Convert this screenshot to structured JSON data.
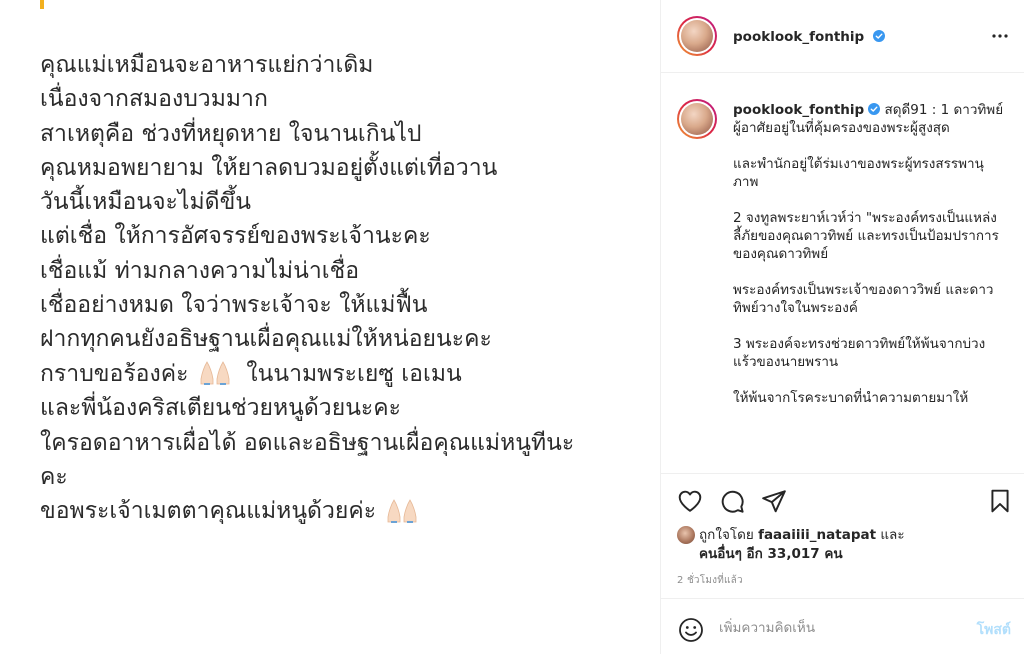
{
  "image": {
    "lines": [
      "คุณแม่เหมือนจะอาหารแย่กว่าเดิม",
      "เนื่องจากสมองบวมมาก",
      "สาเหตุคือ ช่วงที่หยุดหาย ใจนานเกินไป",
      "คุณหมอพยายาม ให้ยาลดบวมอยู่ตั้งแต่เที่อวาน",
      "วันนี้เหมือนจะไม่ดีขึ้น",
      "แต่เชื่อ ให้การอัศจรรย์ของพระเจ้านะคะ",
      "เชื่อแม้ ท่ามกลางความไม่น่าเชื่อ",
      "เชื่ออย่างหมด ใจว่าพระเจ้าจะ ให้แม่ฟื้น",
      "ฝากทุกคนยังอธิษฐานเผื่อคุณแม่ให้หน่อยนะคะ",
      "กราบขอร้องค่ะ",
      "ในนามพระเยซู เอเมน",
      "และพี่น้องคริสเตียนช่วยหนูด้วยนะคะ",
      "ใครอดอาหารเผื่อได้ อดและอธิษฐานเผื่อคุณแม่หนูทีนะ",
      "คะ",
      "ขอพระเจ้าเมตตาคุณแม่หนูด้วยค่ะ"
    ]
  },
  "header": {
    "username": "pooklook_fonthip"
  },
  "caption": {
    "username": "pooklook_fonthip",
    "text_first": "สดุดี91 : 1 ดาวทิพย์ผู้อาศัยอยู่ในที่คุ้มครองของพระผู้สูงสุด",
    "paragraphs": [
      "และพำนักอยู่ใต้ร่มเงาของพระผู้ทรงสรรพานุภาพ",
      "2 จงทูลพระยาห์เวห์ว่า \"พระองค์ทรงเป็นแหล่งลี้ภัยของคุณดาวทิพย์ และทรงเป็นป้อมปราการของคุณดาวทิพย์",
      "พระองค์ทรงเป็นพระเจ้าของดาววิพย์ และดาวทิพย์วางใจในพระองค์",
      "3 พระองค์จะทรงช่วยดาวทิพย์ให้พ้นจากบ่วงแร้วของนายพราน",
      "ให้พ้นจากโรคระบาดที่นำความตายมาให้"
    ]
  },
  "likes": {
    "prefix": "ถูกใจโดย",
    "liker": "faaaiiii_natapat",
    "conj": "และ",
    "others": "คนอื่นๆ อีก 33,017 คน"
  },
  "timestamp": "2 ชั่วโมงที่แล้ว",
  "comment": {
    "placeholder": "เพิ่มความคิดเห็น",
    "post_label": "โพสต์"
  },
  "icons": {
    "more": "more-horizontal-icon",
    "like": "heart-outline-icon",
    "comment": "comment-bubble-icon",
    "share": "paper-plane-icon",
    "save": "bookmark-outline-icon",
    "emoji": "smiley-face-icon",
    "verified": "verified-badge-icon",
    "praying_hands": "praying-hands-emoji"
  },
  "colors": {
    "accent_bar": "#f2b01e",
    "verified": "#3897f0",
    "post_disabled": "#b2dffc",
    "muted_text": "#8e8e8e"
  }
}
